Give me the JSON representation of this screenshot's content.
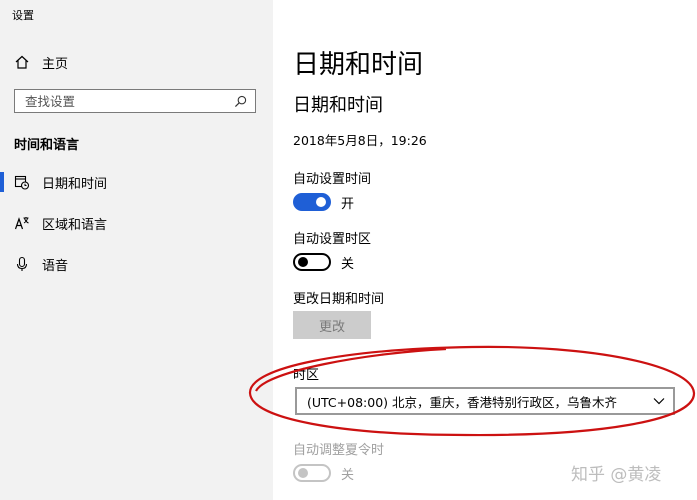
{
  "window": {
    "title": "设置"
  },
  "sidebar": {
    "home_label": "主页",
    "search_placeholder": "查找设置",
    "section_title": "时间和语言",
    "items": [
      {
        "label": "日期和时间",
        "icon": "calendar-clock-icon",
        "active": true
      },
      {
        "label": "区域和语言",
        "icon": "language-icon",
        "active": false
      },
      {
        "label": "语音",
        "icon": "microphone-icon",
        "active": false
      }
    ]
  },
  "main": {
    "page_title": "日期和时间",
    "section_title": "日期和时间",
    "current_datetime": "2018年5月8日，19:26",
    "auto_time": {
      "label": "自动设置时间",
      "state_text": "开",
      "on": true
    },
    "auto_timezone": {
      "label": "自动设置时区",
      "state_text": "关",
      "on": false
    },
    "change_datetime": {
      "label": "更改日期和时间",
      "button_label": "更改"
    },
    "timezone": {
      "label": "时区",
      "selected": "(UTC+08:00) 北京，重庆，香港特别行政区，乌鲁木齐"
    },
    "dst": {
      "label": "自动调整夏令时",
      "state_text": "关",
      "on": false,
      "disabled": true
    }
  },
  "colors": {
    "accent": "#1f5fd6",
    "sidebar_bg": "#f2f2f2",
    "annotation": "#cc1111"
  },
  "watermark": "知乎 @黄凌"
}
